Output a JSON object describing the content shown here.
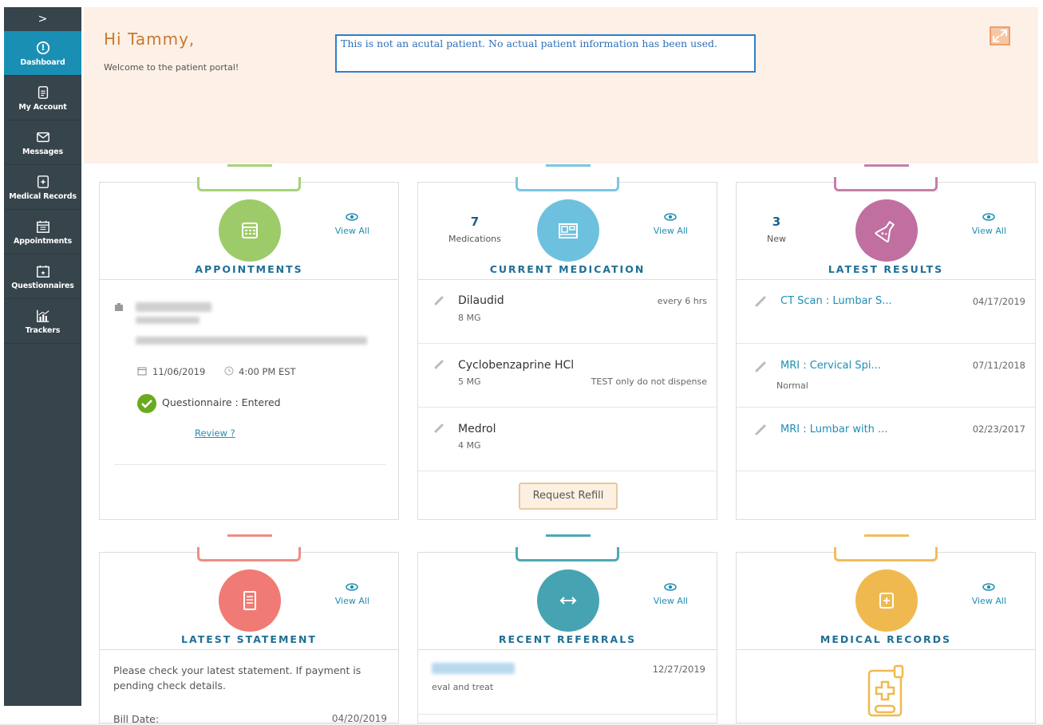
{
  "sidebar": {
    "toggle": ">",
    "items": [
      {
        "label": "Dashboard",
        "icon": "dashboard-icon"
      },
      {
        "label": "My Account",
        "icon": "account-document-icon"
      },
      {
        "label": "Messages",
        "icon": "envelope-icon"
      },
      {
        "label": "Medical Records",
        "icon": "medical-record-icon"
      },
      {
        "label": "Appointments",
        "icon": "calendar-icon"
      },
      {
        "label": "Questionnaires",
        "icon": "questionnaire-icon"
      },
      {
        "label": "Trackers",
        "icon": "chart-icon"
      }
    ]
  },
  "header": {
    "greeting": "Hi Tammy,",
    "welcome": "Welcome to the patient portal!",
    "notice": "This is not an acutal patient. No actual patient information has been used."
  },
  "colors": {
    "green": "#9dcb6a",
    "blue": "#6dc1df",
    "purple": "#c06fa0",
    "red": "#f07b74",
    "teal": "#46a3b2",
    "yellow": "#f0b94f",
    "accent": "#1f8fb5",
    "header_bg": "#fdf0e6",
    "sidebar_bg": "#36444b"
  },
  "cards": {
    "appointments": {
      "title": "APPOINTMENTS",
      "view_all": "View All",
      "date": "11/06/2019",
      "time": "4:00 PM EST",
      "questionnaire": "Questionnaire : Entered",
      "review": "Review ?"
    },
    "medication": {
      "title": "CURRENT MEDICATION",
      "view_all": "View All",
      "count": "7",
      "count_label": "Medications",
      "items": [
        {
          "name": "Dilaudid",
          "dose": "8 MG",
          "note": "every 6 hrs"
        },
        {
          "name": "Cyclobenzaprine HCl",
          "dose": "5 MG",
          "note": "TEST only do not dispense"
        },
        {
          "name": "Medrol",
          "dose": "4 MG",
          "note": ""
        }
      ],
      "refill": "Request Refill"
    },
    "results": {
      "title": "LATEST RESULTS",
      "view_all": "View All",
      "count": "3",
      "count_label": "New",
      "items": [
        {
          "name": "CT Scan : Lumbar S...",
          "date": "04/17/2019",
          "sub": ""
        },
        {
          "name": "MRI : Cervical Spi...",
          "date": "07/11/2018",
          "sub": "Normal"
        },
        {
          "name": "MRI : Lumbar with ...",
          "date": "02/23/2017",
          "sub": ""
        }
      ]
    },
    "statement": {
      "title": "LATEST STATEMENT",
      "view_all": "View All",
      "text": "Please check your latest statement. If payment is pending check details.",
      "bill_label": "Bill Date:",
      "bill_date": "04/20/2019"
    },
    "referrals": {
      "title": "RECENT REFERRALS",
      "view_all": "View All",
      "date": "12/27/2019",
      "note": "eval and treat"
    },
    "records": {
      "title": "MEDICAL RECORDS",
      "view_all": "View All"
    }
  }
}
